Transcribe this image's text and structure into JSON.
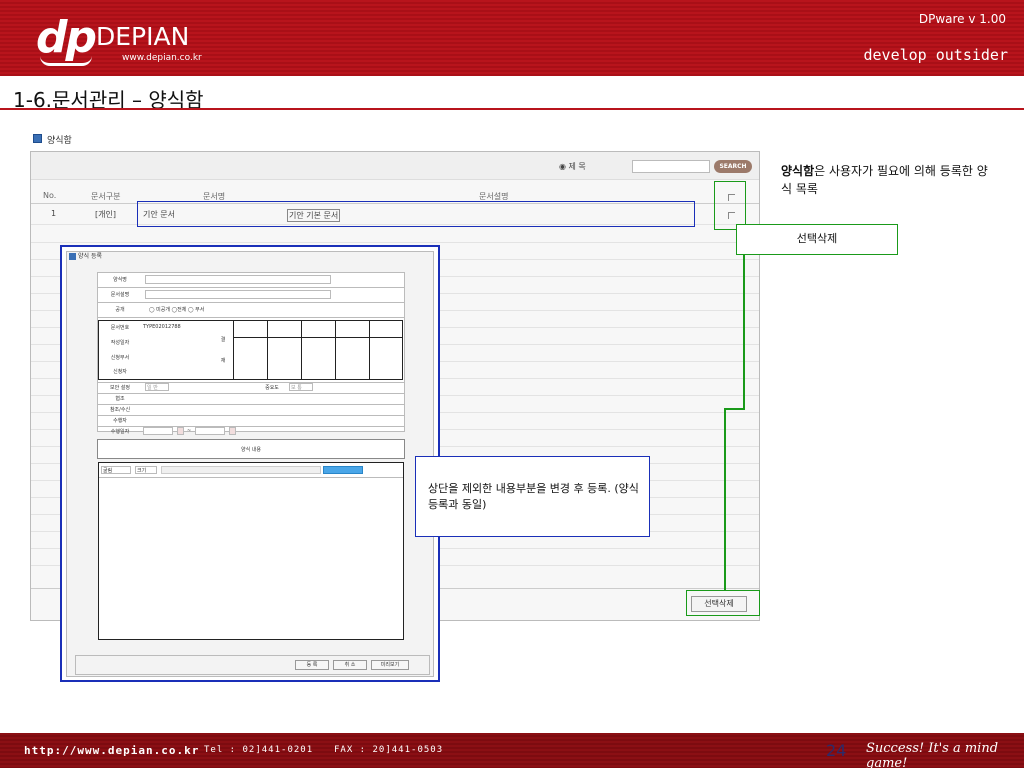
{
  "header": {
    "logo_mark": "dp",
    "logo_name": "DEPIAN",
    "logo_url": "www.depian.co.kr",
    "version": "DPware v 1.00",
    "tagline": "develop outsider"
  },
  "page_title": "1-6.문서관리 – 양식함",
  "panel": {
    "label": "양식함",
    "search_radio_label": "제 목",
    "search_button": "SEARCH",
    "columns": [
      "No.",
      "문서구분",
      "문서명",
      "문서설명"
    ],
    "rows": [
      {
        "no": "1",
        "category": "[개인]",
        "name": "기안 문서",
        "description": "기안 기본 문서"
      }
    ],
    "footer_button": "선택삭제"
  },
  "note": {
    "bold": "양식함",
    "text": "은 사용자가 필요에 의해 등록한 양식 목록"
  },
  "callout_delete": "선택삭제",
  "callout_content": "상단을 제외한 내용부분을 변경 후 등록. (양식등록과 동일)",
  "dialog": {
    "title": "양식 등록",
    "fields": {
      "form_name": "양식명",
      "form_desc": "문서설명",
      "public": "공개",
      "public_options": "◯ 미공개  ◯전체  ◯ 부서",
      "doc_no_label": "문서번호",
      "doc_no_value": "TYPE02012788",
      "created_label": "작성일자",
      "dept_label": "신청부서",
      "requester_label": "신청자",
      "approval_1": "결",
      "approval_2": "재",
      "security_label": "보안 설정",
      "security_value": "일 반",
      "importance_label": "중요도",
      "importance_value": "보 통",
      "agreement_label": "협조",
      "cc_label": "참조/수신",
      "executor_label": "수행자",
      "exec_date_label": "수행일자",
      "exec_date_sep": "~",
      "content_title": "양식 내용",
      "font_select": "굴림",
      "size_select": "크기"
    },
    "buttons": [
      "등 록",
      "취 소",
      "미리보기"
    ]
  },
  "footer": {
    "url": "http://www.depian.co.kr",
    "tel": "Tel : 02]441-0201",
    "fax": "FAX : 20]441-0503",
    "page_number": "24",
    "slogan": "Success! It's a mind game!"
  },
  "colors": {
    "brand_red": "#b8141c",
    "annotation_blue": "#1a2fb8",
    "annotation_green": "#1a9a1a"
  }
}
